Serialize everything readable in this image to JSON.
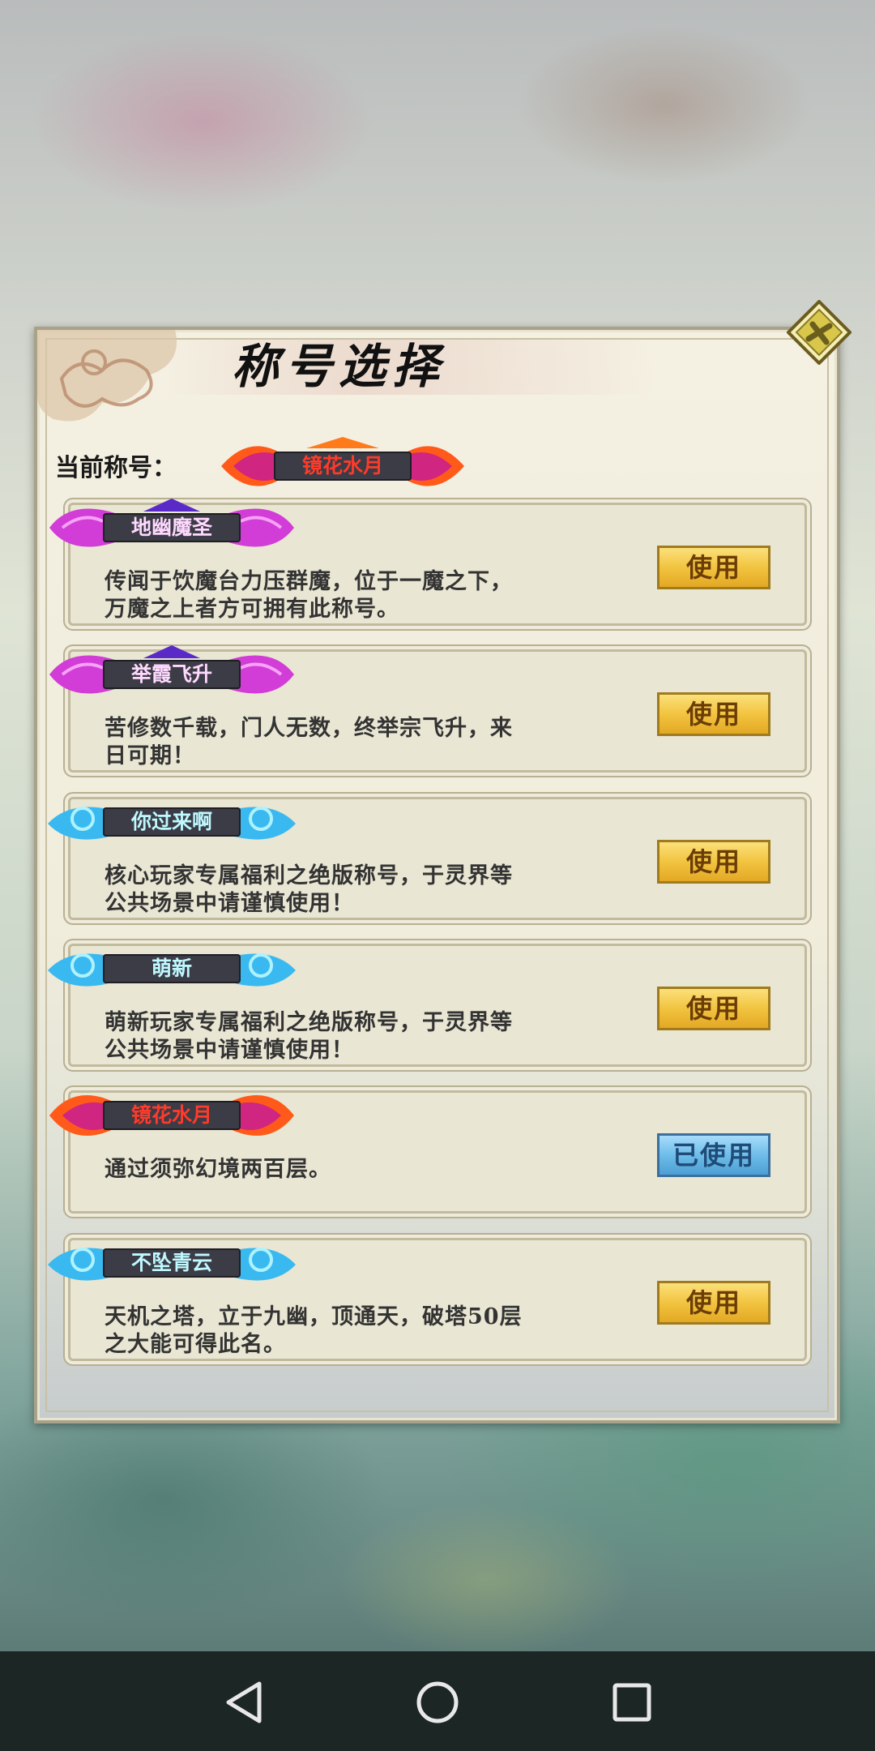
{
  "dialog": {
    "title": "称号选择",
    "current_label": "当前称号：",
    "current_title": "镜花水月"
  },
  "titles": [
    {
      "name": "地幽魔圣",
      "style": "purple",
      "desc_line1": "传闻于饮魔台力压群魔，位于一魔之下，",
      "desc_line2": "万魔之上者方可拥有此称号。",
      "button": "使用"
    },
    {
      "name": "举霞飞升",
      "style": "purple",
      "desc_line1": "苦修数千载，门人无数，终举宗飞升，来",
      "desc_line2": "日可期！",
      "button": "使用"
    },
    {
      "name": "你过来啊",
      "style": "cyan",
      "desc_line1": "核心玩家专属福利之绝版称号，于灵界等",
      "desc_line2": "公共场景中请谨慎使用！",
      "button": "使用"
    },
    {
      "name": "萌新",
      "style": "cyan",
      "desc_line1": "萌新玩家专属福利之绝版称号，于灵界等",
      "desc_line2": "公共场景中请谨慎使用！",
      "button": "使用"
    },
    {
      "name": "镜花水月",
      "style": "fire",
      "desc_line1": "通过须弥幻境两百层。",
      "desc_line2": "",
      "button": "已使用"
    },
    {
      "name": "不坠青云",
      "style": "cyan",
      "desc_line1": "天机之塔，立于九幽，顶通天，破塔50层",
      "desc_line2": "之大能可得此名。",
      "button": "使用"
    }
  ],
  "colors": {
    "purple_text": "#ffd9ff",
    "cyan_text": "#bff8ff",
    "fire_text": "#ff3a2a",
    "button_gold": "#f2c440",
    "button_used": "#6ebde9"
  },
  "icons": {
    "close": "close-icon",
    "nav_back": "back-triangle-icon",
    "nav_home": "home-circle-icon",
    "nav_recent": "recent-square-icon"
  }
}
